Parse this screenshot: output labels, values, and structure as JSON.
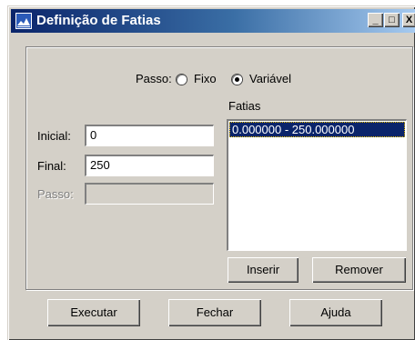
{
  "window": {
    "title": "Definição de Fatias",
    "controls": {
      "minimize": "_",
      "maximize": "□",
      "close": "X"
    }
  },
  "step_mode": {
    "label": "Passo:",
    "options": [
      "Fixo",
      "Variável"
    ],
    "selected": "Variável"
  },
  "fields": {
    "inicial_label": "Inicial:",
    "inicial_value": "0",
    "final_label": "Final:",
    "final_value": "250",
    "passo_label": "Passo:",
    "passo_value": ""
  },
  "slices": {
    "label": "Fatias",
    "items": [
      "0.000000 - 250.000000"
    ]
  },
  "buttons": {
    "inserir": "Inserir",
    "remover": "Remover",
    "executar": "Executar",
    "fechar": "Fechar",
    "ajuda": "Ajuda"
  }
}
